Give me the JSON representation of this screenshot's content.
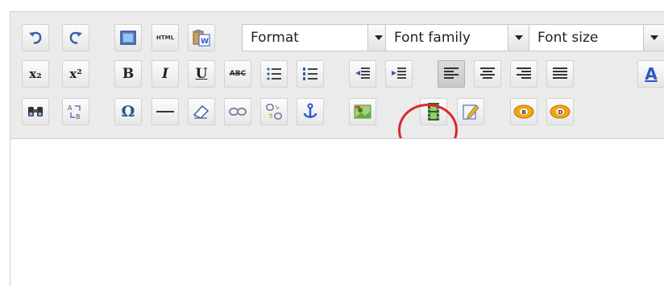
{
  "toolbar": {
    "format": {
      "label": "Format"
    },
    "font_family": {
      "label": "Font family"
    },
    "font_size": {
      "label": "Font size"
    },
    "html_icon_text": "HTML",
    "subscript_text": "x₂",
    "superscript_text": "x²",
    "bold_text": "B",
    "italic_text": "I",
    "underline_text": "U",
    "strikethrough_text": "ABC",
    "omega_text": "Ω",
    "text_color_text": "A"
  },
  "icons": {
    "undo": "undo-icon",
    "redo": "redo-icon",
    "fullscreen": "fullscreen-icon",
    "html": "html-source-icon",
    "paste_word": "paste-from-word-icon",
    "insert_movie": "insert-movie-icon"
  },
  "colors": {
    "highlight_circle": "#d9272e",
    "toolbar_bg": "#ebebeb",
    "text_color_accent": "#2f56c8"
  },
  "content": {
    "text": ""
  }
}
